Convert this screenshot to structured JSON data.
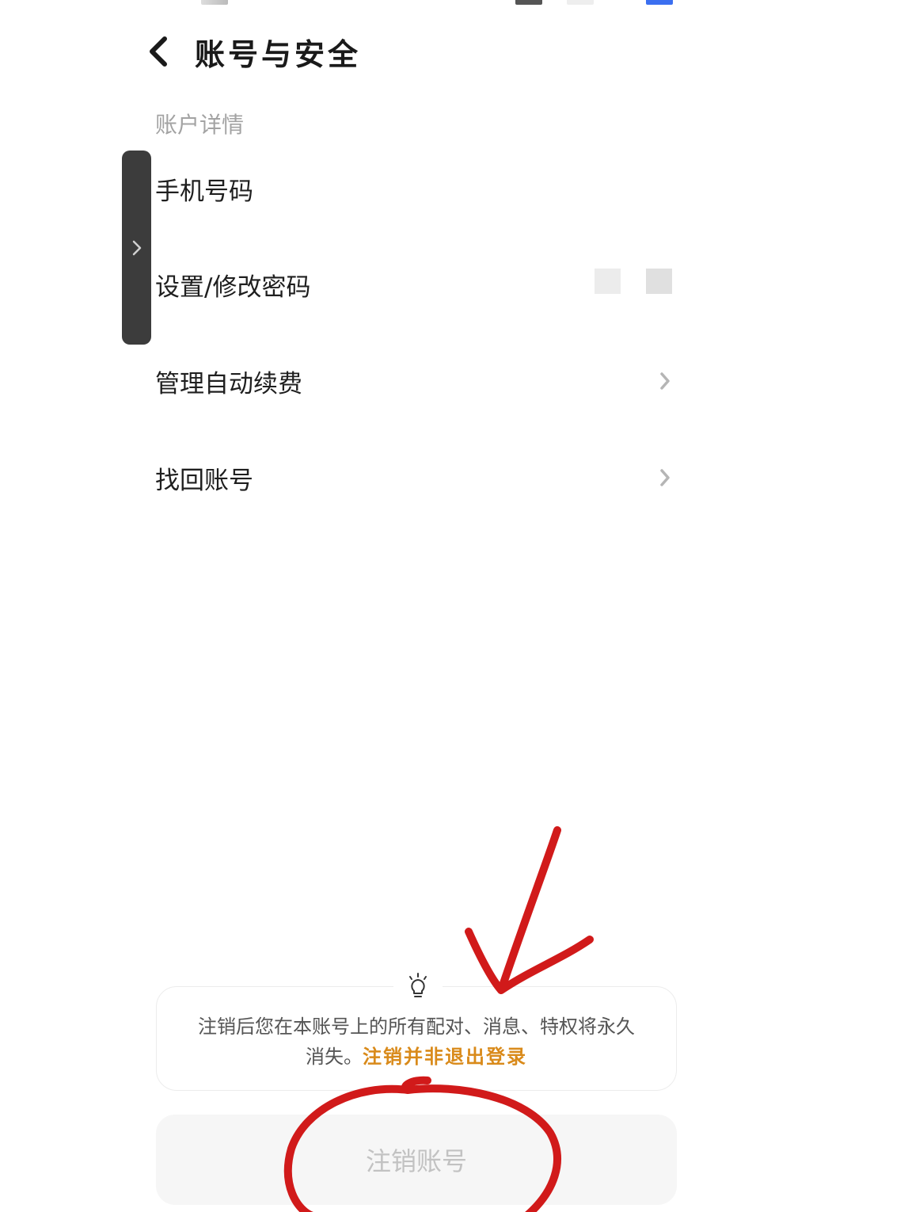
{
  "header": {
    "title": "账号与安全"
  },
  "section": {
    "label": "账户详情"
  },
  "rows": [
    {
      "label": "手机号码"
    },
    {
      "label": "设置/修改密码"
    },
    {
      "label": "管理自动续费"
    },
    {
      "label": "找回账号"
    }
  ],
  "notice": {
    "text": "注销后您在本账号上的所有配对、消息、特权将永久消失。",
    "line1": "注销后您在本账号上的所有配对、消息、特权将永久",
    "line2": "消失。",
    "warning": "注销并非退出登录"
  },
  "delete_button": {
    "label": "注销账号"
  },
  "icons": {
    "back": "chevron-left-icon",
    "row_chevron": "chevron-right-icon",
    "side_handle": "chevron-right-icon",
    "notice": "lightbulb-icon"
  },
  "colors": {
    "warning": "#d98a1a",
    "annotation": "#d11a1a"
  }
}
